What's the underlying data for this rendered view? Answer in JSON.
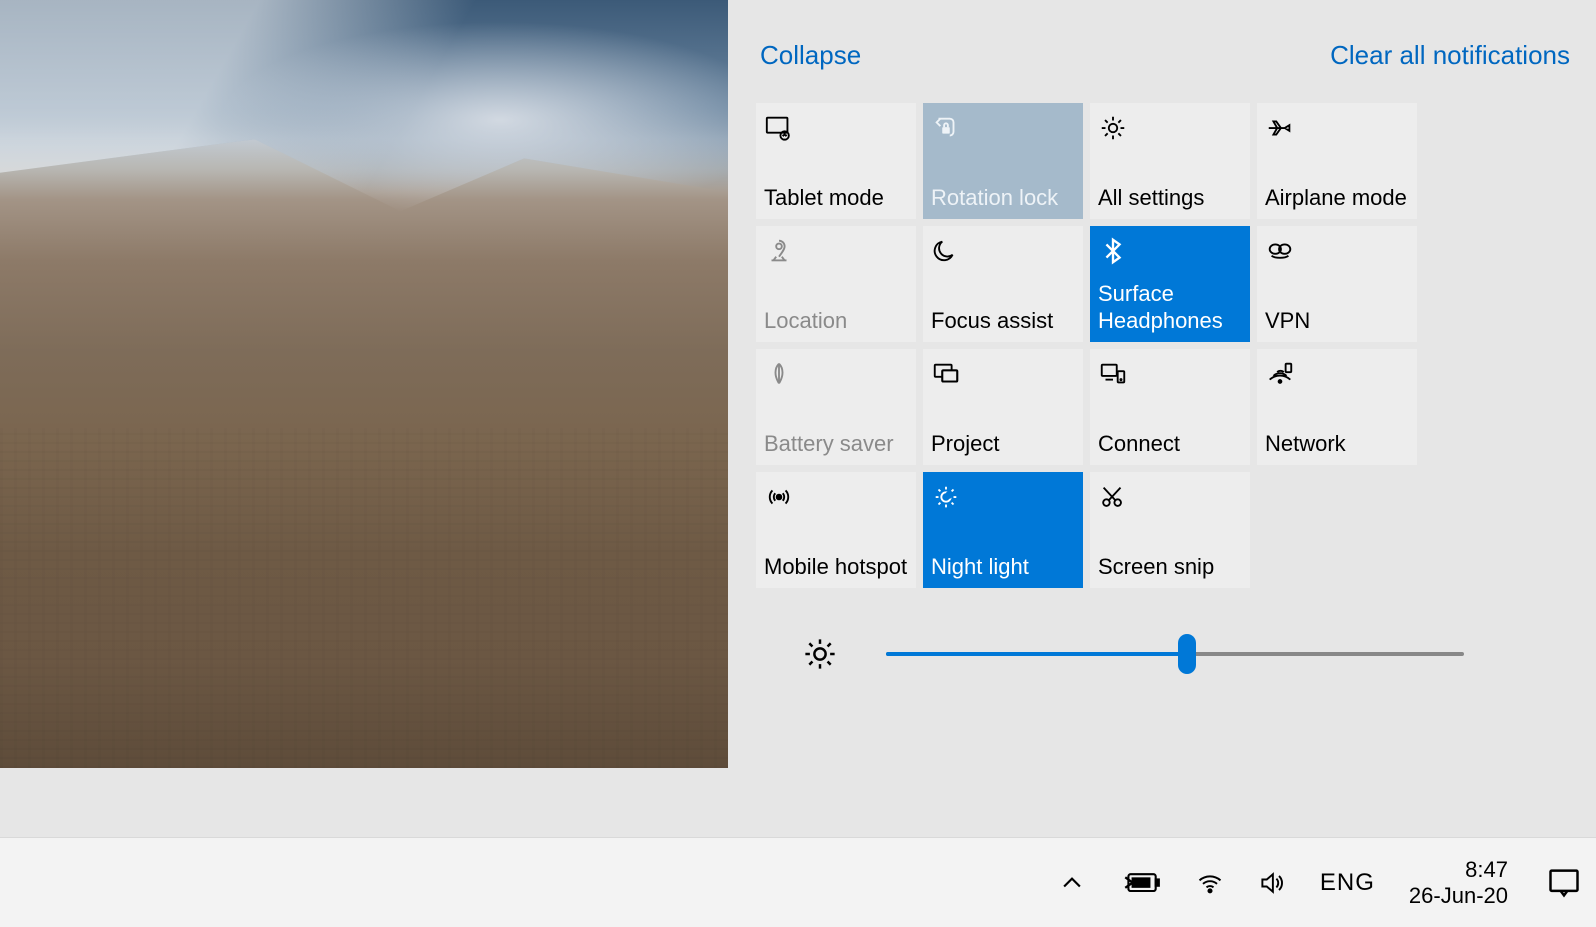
{
  "action_center": {
    "collapse_label": "Collapse",
    "clear_label": "Clear all notifications",
    "brightness_percent": 52,
    "tiles": [
      {
        "id": "tablet-mode",
        "label": "Tablet mode",
        "icon": "tablet-icon",
        "state": "normal"
      },
      {
        "id": "rotation-lock",
        "label": "Rotation lock",
        "icon": "rotation-lock-icon",
        "state": "rotation"
      },
      {
        "id": "all-settings",
        "label": "All settings",
        "icon": "gear-icon",
        "state": "normal"
      },
      {
        "id": "airplane-mode",
        "label": "Airplane mode",
        "icon": "airplane-icon",
        "state": "normal"
      },
      {
        "id": "location",
        "label": "Location",
        "icon": "location-icon",
        "state": "disabled"
      },
      {
        "id": "focus-assist",
        "label": "Focus assist",
        "icon": "moon-icon",
        "state": "normal"
      },
      {
        "id": "bluetooth",
        "label": "Surface\nHeadphones",
        "icon": "bluetooth-icon",
        "state": "active"
      },
      {
        "id": "vpn",
        "label": "VPN",
        "icon": "vpn-icon",
        "state": "normal"
      },
      {
        "id": "battery-saver",
        "label": "Battery saver",
        "icon": "leaf-icon",
        "state": "disabled"
      },
      {
        "id": "project",
        "label": "Project",
        "icon": "project-icon",
        "state": "normal"
      },
      {
        "id": "connect",
        "label": "Connect",
        "icon": "connect-icon",
        "state": "normal"
      },
      {
        "id": "network",
        "label": "Network",
        "icon": "network-icon",
        "state": "normal"
      },
      {
        "id": "mobile-hotspot",
        "label": "Mobile hotspot",
        "icon": "hotspot-icon",
        "state": "normal"
      },
      {
        "id": "night-light",
        "label": "Night light",
        "icon": "night-light-icon",
        "state": "active"
      },
      {
        "id": "screen-snip",
        "label": "Screen snip",
        "icon": "snip-icon",
        "state": "normal"
      }
    ]
  },
  "taskbar": {
    "language": "ENG",
    "time": "8:47",
    "date": "26-Jun-20"
  },
  "icons": {
    "tablet-icon": "<svg viewBox='0 0 32 32' fill='none' stroke='currentColor' stroke-width='2'><rect x='3' y='5' width='22' height='16' rx='1'/><circle cx='22' cy='24' r='4.5'/><path d='M22 21.5v2.5M22 27v-0.01M19.8 23.2l1.6 1.6M24.2 23.2l-1.6 1.6'/></svg>",
    "rotation-lock-icon": "<svg viewBox='0 0 32 32' fill='none' stroke='currentColor' stroke-width='2'><path d='M8 6l12 0a4 4 0 0 1 4 4l0 10a4 4 0 0 1-4 4'/><path d='M10 6l-4 4 4 4' /><rect x='12' y='15' width='8' height='7' rx='1' fill='currentColor' stroke='none'/><path d='M14 15v-2a2 2 0 0 1 4 0v2'/></svg>",
    "gear-icon": "<svg viewBox='0 0 32 32' fill='none' stroke='currentColor' stroke-width='2'><circle cx='16' cy='16' r='4.5'/><path d='M16 4v4M16 24v4M4 16h4M24 16h4M7.5 7.5l2.8 2.8M21.7 21.7l2.8 2.8M24.5 7.5l-2.8 2.8M10.3 21.7l-2.8 2.8'/></svg>",
    "airplane-icon": "<svg viewBox='0 0 32 32' fill='none' stroke='currentColor' stroke-width='2'><path d='M4 16h17l5-3v6l-5-3M13 16l-4 7h3l5-7M13 16l-4-7h3l5 7'/></svg>",
    "location-icon": "<svg viewBox='0 0 32 32' fill='none' stroke='currentColor' stroke-width='2'><circle cx='16' cy='11' r='3'/><path d='M16 5a6 6 0 0 1 6 6c0 3-3 7-6 11'/><path d='M8 26h16'/><path d='M13 22l-3 4M19 22l3 4'/></svg>",
    "moon-icon": "<svg viewBox='0 0 32 32' fill='none' stroke='currentColor' stroke-width='2'><path d='M23 20a10 10 0 1 1-11-14 8 8 0 0 0 11 14z'/></svg>",
    "bluetooth-icon": "<svg viewBox='0 0 32 32' fill='none' stroke='currentColor' stroke-width='2.5'><path d='M9 9l14 14-7 5V4l7 5L9 23'/></svg>",
    "vpn-icon": "<svg viewBox='0 0 32 32' fill='none' stroke='currentColor' stroke-width='2'><ellipse cx='11' cy='14' rx='6' ry='5'/><ellipse cx='21' cy='14' rx='6' ry='5'/><path d='M7 21c4 3 14 3 18 0'/></svg>",
    "leaf-icon": "<svg viewBox='0 0 32 32' fill='none' stroke='currentColor' stroke-width='2'><path d='M16 5c5 5 5 13 0 21M16 5c-5 5-5 13 0 21'/><path d='M16 5v21'/></svg>",
    "project-icon": "<svg viewBox='0 0 32 32' fill='none' stroke='currentColor' stroke-width='2'><rect x='4' y='6' width='18' height='13' rx='1'/><rect x='12' y='12' width='16' height='12' rx='1' fill='#ededed'/><rect x='12' y='12' width='16' height='12' rx='1'/></svg>",
    "connect-icon": "<svg viewBox='0 0 32 32' fill='none' stroke='currentColor' stroke-width='2'><rect x='4' y='6' width='16' height='12' rx='1'/><path d='M8 22h8'/><rect x='21' y='13' width='7' height='12' rx='1'/><circle cx='24.5' cy='22' r='0.6' fill='currentColor'/></svg>",
    "network-icon": "<svg viewBox='0 0 32 32' fill='none' stroke='currentColor' stroke-width='2'><path d='M5 22a16 16 0 0 1 22 0M9 18a10 10 0 0 1 14 0M13 14a5 5 0 0 1 7 0'/><circle cx='16' cy='24' r='1.5' fill='currentColor'/><rect x='22' y='5' width='6' height='9' rx='1'/></svg>",
    "hotspot-icon": "<svg viewBox='0 0 32 32' fill='none' stroke='currentColor' stroke-width='2'><circle cx='16' cy='16' r='2.5' fill='currentColor'/><path d='M9 23a10 10 0 0 1 0-14M23 9a10 10 0 0 1 0 14M12 20a6 6 0 0 1 0-8M20 12a6 6 0 0 1 0 8'/></svg>",
    "night-light-icon": "<svg viewBox='0 0 32 32' fill='none' stroke='currentColor' stroke-width='2'><circle cx='16' cy='16' r='5'/><circle cx='19' cy='14' r='4' fill='#0078d7' stroke='none'/><path d='M16 5v3M16 24v3M5 16h3M24 16h3M8 8l2 2M22 22l2 2M24 8l-2 2M10 22l-2 2'/></svg>",
    "snip-icon": "<svg viewBox='0 0 32 32' fill='none' stroke='currentColor' stroke-width='2'><circle cx='9' cy='22' r='3.5'/><circle cx='21' cy='22' r='3.5'/><path d='M11.5 19.5L24 6M18.5 19.5L6 6'/></svg>",
    "sun-icon": "<svg viewBox='0 0 32 32' fill='none' stroke='currentColor' stroke-width='2.2'><circle cx='16' cy='16' r='5'/><path d='M16 3v4M16 25v4M3 16h4M25 16h4M6.5 6.5l2.8 2.8M22.7 22.7l2.8 2.8M25.5 6.5l-2.8 2.8M9.3 22.7l-2.8 2.8'/></svg>",
    "chevron-up-icon": "<svg viewBox='0 0 32 32' fill='none' stroke='currentColor' stroke-width='2.5'><path d='M7 20l9-9 9 9'/></svg>",
    "battery-icon": "<svg viewBox='0 0 40 24' fill='none' stroke='currentColor' stroke-width='2'><rect x='8' y='4' width='26' height='16' rx='2'/><rect x='34' y='9' width='3' height='6' fill='currentColor'/><rect x='11' y='7' width='18' height='10' fill='currentColor' stroke='none'/><path d='M5 7 L12 12 L5 17' stroke-width='2.2'/></svg>",
    "wifi-icon": "<svg viewBox='0 0 32 32' fill='none' stroke='currentColor' stroke-width='2.2'><path d='M4 13a18 18 0 0 1 24 0M8 17a12 12 0 0 1 16 0M12 21a6 6 0 0 1 8 0'/><circle cx='16' cy='25' r='1.8' fill='currentColor'/></svg>",
    "volume-icon": "<svg viewBox='0 0 32 32' fill='none' stroke='currentColor' stroke-width='2.2'><path d='M5 12h5l7-6v20l-7-6H5z'/><path d='M21 11a7 7 0 0 1 0 10M24 8a11 11 0 0 1 0 16'/></svg>",
    "ac-icon": "<svg viewBox='0 0 32 32' fill='none' stroke='currentColor' stroke-width='2.2'><rect x='4' y='5' width='24' height='18' rx='1'/><path d='M13 23l3 4 3-4'/></svg>"
  }
}
